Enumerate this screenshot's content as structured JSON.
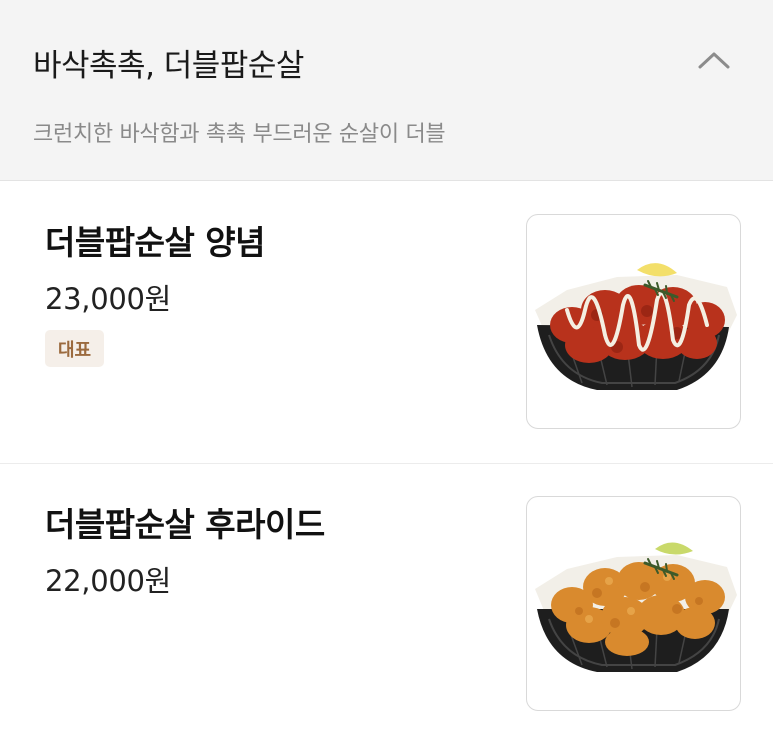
{
  "section": {
    "title": "바삭촉촉, 더블팝순살",
    "description": "크런치한 바삭함과 촉촉 부드러운 순살이 더블",
    "toggle_icon": "chevron-up-icon"
  },
  "items": [
    {
      "name": "더블팝순살 양념",
      "price": "23,000원",
      "badge": "대표",
      "image_alt": "양념치킨 바스켓",
      "chicken_color": "#b8321c"
    },
    {
      "name": "더블팝순살 후라이드",
      "price": "22,000원",
      "image_alt": "후라이드치킨 바스켓",
      "chicken_color": "#d98a2e"
    }
  ],
  "colors": {
    "header_bg": "#f4f4f4",
    "badge_bg": "#f5efe9",
    "badge_text": "#9b6a3e"
  }
}
